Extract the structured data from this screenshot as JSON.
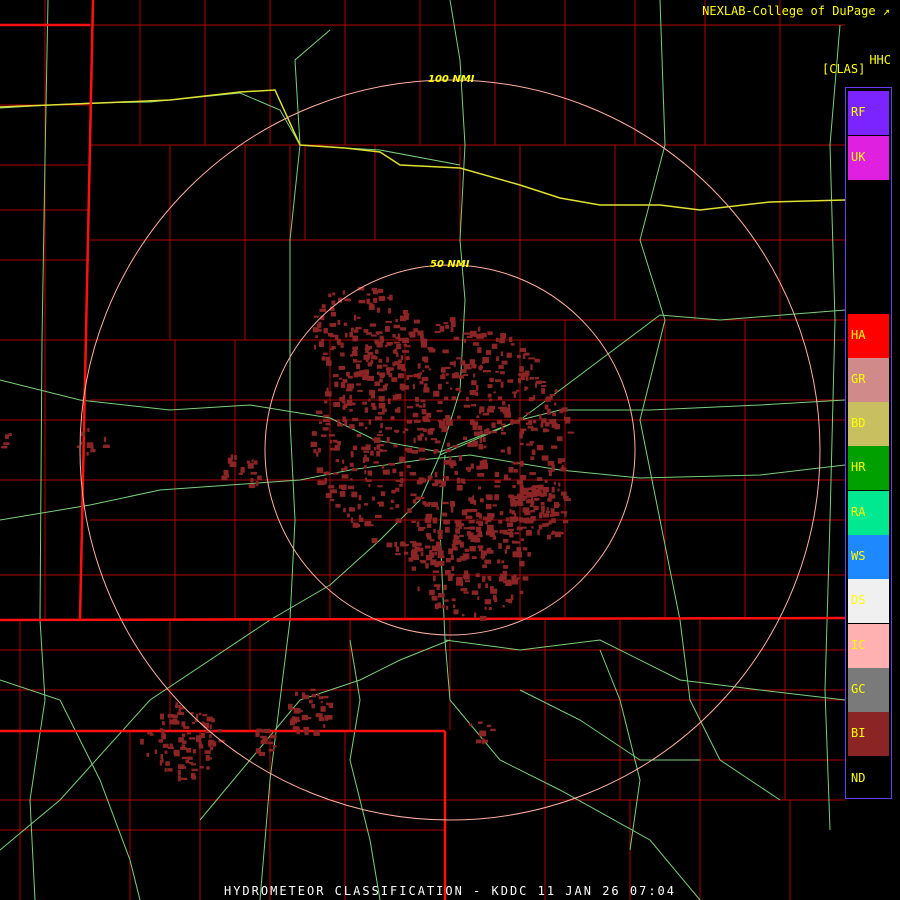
{
  "header": {
    "credit": "NEXLAB-College of DuPage ↗",
    "product_code": "HHC",
    "product_abbrev": "[CLAS]"
  },
  "range_rings": [
    {
      "label": "100 NMI"
    },
    {
      "label": "50 NMI"
    }
  ],
  "legend": {
    "items": [
      {
        "code": "RF",
        "color": "#7b24ff"
      },
      {
        "code": "UK",
        "color": "#e020e0"
      },
      {
        "code": "HA",
        "color": "#ff0000"
      },
      {
        "code": "GR",
        "color": "#d08a8a"
      },
      {
        "code": "BD",
        "color": "#c8c060"
      },
      {
        "code": "HR",
        "color": "#00a000"
      },
      {
        "code": "RA",
        "color": "#00e890"
      },
      {
        "code": "WS",
        "color": "#1e88ff"
      },
      {
        "code": "DS",
        "color": "#f0f0f0"
      },
      {
        "code": "IC",
        "color": "#ffb0b0"
      },
      {
        "code": "GC",
        "color": "#7a7a7a"
      },
      {
        "code": "BI",
        "color": "#8b2525"
      },
      {
        "code": "ND",
        "color": "#000000"
      }
    ]
  },
  "map": {
    "county_color": "#b00000",
    "state_color": "#ff1010",
    "road_color": "#7ad07a",
    "river_color": "#e0e030",
    "ring_color": "#ffb0a0",
    "echo_color": "#8b2525"
  },
  "footer": {
    "title": "HYDROMETEOR CLASSIFICATION - KDDC 11 JAN 26 07:04"
  }
}
